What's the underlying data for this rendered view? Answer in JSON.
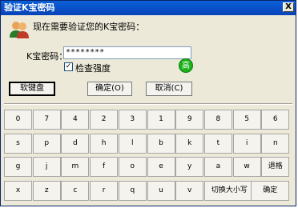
{
  "window": {
    "title": "验证K宝密码",
    "close_glyph": "X"
  },
  "prompt": "现在需要验证您的K宝密码：",
  "password": {
    "label": "K宝密码：",
    "value": "********"
  },
  "strength_badge": {
    "text": "高",
    "color": "#1db31d"
  },
  "check_strength": {
    "label": "检查强度",
    "checked": true,
    "check_glyph": "✓"
  },
  "buttons": {
    "soft_keyboard": "软键盘",
    "ok": "确定(O)",
    "cancel": "取消(C)"
  },
  "keypad": {
    "rows": [
      [
        "0",
        "7",
        "4",
        "2",
        "3",
        "1",
        "9",
        "8",
        "5",
        "6"
      ],
      [
        "s",
        "p",
        "d",
        "h",
        "l",
        "b",
        "k",
        "t",
        "i",
        "n"
      ],
      [
        "g",
        "j",
        "m",
        "f",
        "o",
        "e",
        "y",
        "a",
        "w"
      ],
      [
        "x",
        "z",
        "c",
        "r",
        "q",
        "u",
        "v"
      ]
    ],
    "backspace": "退格",
    "caps": "切换大小写",
    "enter": "确定"
  }
}
